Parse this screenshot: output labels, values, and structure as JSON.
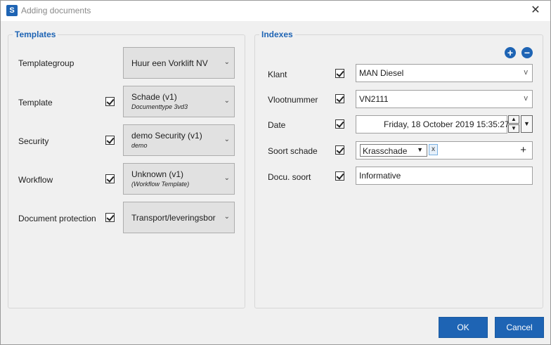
{
  "window": {
    "title": "Adding documents",
    "app_icon_glyph": "S"
  },
  "templates": {
    "title": "Templates",
    "rows": [
      {
        "label": "Templategroup",
        "value": "Huur een Vorklift NV",
        "sub": "",
        "checked": false
      },
      {
        "label": "Template",
        "value": "Schade (v1)",
        "sub": "Documenttype 3vd3",
        "checked": true
      },
      {
        "label": "Security",
        "value": "demo Security (v1)",
        "sub": "demo",
        "checked": true
      },
      {
        "label": "Workflow",
        "value": "Unknown (v1)",
        "sub": "(Workflow Template)",
        "checked": true
      },
      {
        "label": "Document protection",
        "value": "Transport/leveringsbor",
        "sub": "",
        "checked": true
      }
    ]
  },
  "indexes": {
    "title": "Indexes",
    "add_glyph": "+",
    "remove_glyph": "−",
    "klant": {
      "label": "Klant",
      "value": "MAN Diesel"
    },
    "vlootnummer": {
      "label": "Vlootnummer",
      "value": "VN2111"
    },
    "date": {
      "label": "Date",
      "value": "Friday, 18 October 2019 15:35:27"
    },
    "soort_schade": {
      "label": "Soort schade",
      "tag": "Krasschade",
      "tag_remove": "x",
      "add": "+"
    },
    "docu_soort": {
      "label": "Docu. soort",
      "value": "Informative"
    }
  },
  "icons": {
    "dropdown": "⌄",
    "chevron": "v",
    "up": "▲",
    "down": "▼",
    "close": "✕"
  },
  "buttons": {
    "ok": "OK",
    "cancel": "Cancel"
  },
  "colors": {
    "accent": "#1e64b4",
    "title_text": "#8a8a8a",
    "panel_bg": "#f0f0f0"
  }
}
